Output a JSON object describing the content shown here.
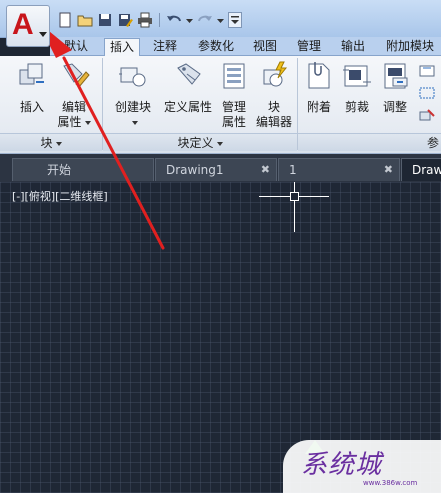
{
  "quick_access": {
    "icons": [
      "new-icon",
      "open-icon",
      "save-icon",
      "saveas-icon",
      "print-icon",
      "undo-icon",
      "redo-icon",
      "customize-icon"
    ]
  },
  "ribbon_tabs": [
    {
      "label": "默认"
    },
    {
      "label": "插入"
    },
    {
      "label": "注释"
    },
    {
      "label": "参数化"
    },
    {
      "label": "视图"
    },
    {
      "label": "管理"
    },
    {
      "label": "输出"
    },
    {
      "label": "附加模块"
    }
  ],
  "panels": {
    "block": {
      "title": "块",
      "buttons": {
        "insert": "插入",
        "edit_attr_1": "编辑",
        "edit_attr_2": "属性"
      }
    },
    "block_def": {
      "title": "块定义",
      "buttons": {
        "create": "创建块",
        "define_attr": "定义属性",
        "manage_attr_1": "管理",
        "manage_attr_2": "属性",
        "block_editor_1": "块",
        "block_editor_2": "编辑器"
      }
    },
    "reference": {
      "title": "参",
      "buttons": {
        "attach": "附着",
        "clip": "剪裁",
        "adjust": "调整"
      }
    }
  },
  "doc_tabs": [
    {
      "label": "开始"
    },
    {
      "label": "Drawing1"
    },
    {
      "label": "1"
    },
    {
      "label": "Draw"
    }
  ],
  "viewport_label": "[-][俯视][二维线框]",
  "watermark": {
    "text": "系统城",
    "url": "www.386w.com"
  },
  "colors": {
    "canvas_bg": "#1f2735",
    "logo_red": "#c8151b",
    "arrow_red": "#e02020"
  }
}
